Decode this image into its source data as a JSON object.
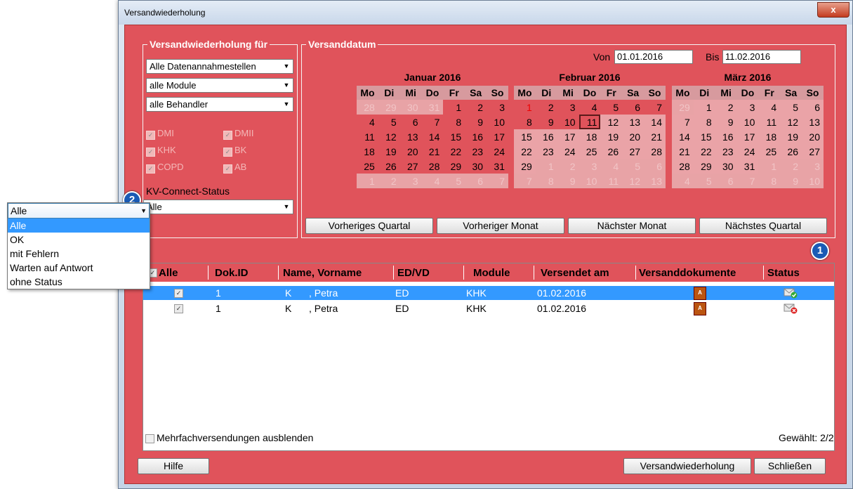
{
  "window": {
    "title": "Versandwiederholung",
    "close_label": "x"
  },
  "groups": {
    "versand_fuer_title": "Versandwiederholung für",
    "datum_title": "Versanddatum"
  },
  "filters": {
    "datenannahme": "Alle Datenannahmestellen",
    "module": "alle Module",
    "behandler": "alle Behandler",
    "checkboxes": [
      {
        "label": "DMI",
        "checked": true
      },
      {
        "label": "DMII",
        "checked": true
      },
      {
        "label": "KHK",
        "checked": true
      },
      {
        "label": "BK",
        "checked": true
      },
      {
        "label": "COPD",
        "checked": true
      },
      {
        "label": "AB",
        "checked": true
      }
    ],
    "kv_status_label": "KV-Connect-Status",
    "kv_status_value": "Alle"
  },
  "dates": {
    "von_label": "Von",
    "von_value": "01.01.2016",
    "bis_label": "Bis",
    "bis_value": "11.02.2016"
  },
  "calendars": [
    {
      "title": "Januar 2016",
      "weekdays": [
        "Mo",
        "Di",
        "Mi",
        "Do",
        "Fr",
        "Sa",
        "So"
      ],
      "rows": [
        [
          "28",
          "29",
          "30",
          "31",
          "1",
          "2",
          "3"
        ],
        [
          "4",
          "5",
          "6",
          "7",
          "8",
          "9",
          "10"
        ],
        [
          "11",
          "12",
          "13",
          "14",
          "15",
          "16",
          "17"
        ],
        [
          "18",
          "19",
          "20",
          "21",
          "22",
          "23",
          "24"
        ],
        [
          "25",
          "26",
          "27",
          "28",
          "29",
          "30",
          "31"
        ],
        [
          "1",
          "2",
          "3",
          "4",
          "5",
          "6",
          "7"
        ]
      ]
    },
    {
      "title": "Februar 2016",
      "weekdays": [
        "Mo",
        "Di",
        "Mi",
        "Do",
        "Fr",
        "Sa",
        "So"
      ],
      "rows": [
        [
          "1",
          "2",
          "3",
          "4",
          "5",
          "6",
          "7"
        ],
        [
          "8",
          "9",
          "10",
          "11",
          "12",
          "13",
          "14"
        ],
        [
          "15",
          "16",
          "17",
          "18",
          "19",
          "20",
          "21"
        ],
        [
          "22",
          "23",
          "24",
          "25",
          "26",
          "27",
          "28"
        ],
        [
          "29",
          "1",
          "2",
          "3",
          "4",
          "5",
          "6"
        ],
        [
          "7",
          "8",
          "9",
          "10",
          "11",
          "12",
          "13"
        ]
      ]
    },
    {
      "title": "März 2016",
      "weekdays": [
        "Mo",
        "Di",
        "Mi",
        "Do",
        "Fr",
        "Sa",
        "So"
      ],
      "rows": [
        [
          "29",
          "1",
          "2",
          "3",
          "4",
          "5",
          "6"
        ],
        [
          "7",
          "8",
          "9",
          "10",
          "11",
          "12",
          "13"
        ],
        [
          "14",
          "15",
          "16",
          "17",
          "18",
          "19",
          "20"
        ],
        [
          "21",
          "22",
          "23",
          "24",
          "25",
          "26",
          "27"
        ],
        [
          "28",
          "29",
          "30",
          "31",
          "1",
          "2",
          "3"
        ],
        [
          "4",
          "5",
          "6",
          "7",
          "8",
          "9",
          "10"
        ]
      ]
    }
  ],
  "nav_buttons": {
    "prev_quarter": "Vorheriges Quartal",
    "prev_month": "Vorheriger Monat",
    "next_month": "Nächster Monat",
    "next_quarter": "Nächstes Quartal"
  },
  "table": {
    "columns": [
      "Alle",
      "Dok.ID",
      "Name, Vorname",
      "ED/VD",
      "Module",
      "Versendet am",
      "Versanddokumente",
      "Status"
    ],
    "rows": [
      {
        "checked": true,
        "dok_id": "1",
        "nachname": "K",
        "vorname": ", Petra",
        "edvd": "ED",
        "module": "KHK",
        "versendet": "01.02.2016",
        "status": "ok"
      },
      {
        "checked": true,
        "dok_id": "1",
        "nachname": "K",
        "vorname": ", Petra",
        "edvd": "ED",
        "module": "KHK",
        "versendet": "01.02.2016",
        "status": "error"
      }
    ]
  },
  "footer": {
    "mehrfach_label": "Mehrfachversendungen ausblenden",
    "gewaehlt": "Gewählt: 2/2",
    "hilfe": "Hilfe",
    "versandwiederholung": "Versandwiederholung",
    "schliessen": "Schließen"
  },
  "dropdown": {
    "current": "Alle",
    "options": [
      "Alle",
      "OK",
      "mit Fehlern",
      "Warten auf Antwort",
      "ohne Status"
    ],
    "selected_index": 0
  },
  "badges": {
    "one": "1",
    "two": "2"
  },
  "colors": {
    "client_bg": "#e0535b",
    "selection": "#3399ff",
    "badge": "#1a5bb5"
  }
}
